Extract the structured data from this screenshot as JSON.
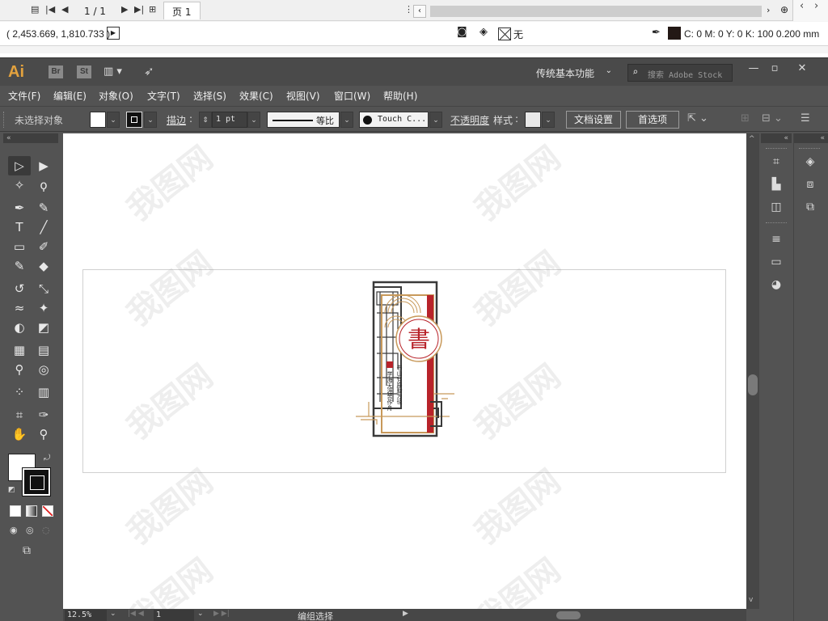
{
  "viewer": {
    "page_indicator": "1 / 1",
    "page_tab": "页 1",
    "coords": "( 2,453.669, 1,810.733 )",
    "stroke_none_label": "无",
    "color_readout": "C: 0 M: 0 Y: 0 K: 100  0.200 mm",
    "color_swatch": "#231815"
  },
  "app": {
    "logo": "Ai",
    "bridge": "Br",
    "stock": "St",
    "workspace": "传统基本功能",
    "search_placeholder": "搜索 Adobe Stock"
  },
  "menu": {
    "items": [
      "文件(F)",
      "编辑(E)",
      "对象(O)",
      "文字(T)",
      "选择(S)",
      "效果(C)",
      "视图(V)",
      "窗口(W)",
      "帮助(H)"
    ]
  },
  "control": {
    "selection": "未选择对象",
    "stroke_label": "描边",
    "stroke_weight": "1 pt",
    "profile": "等比",
    "brush": "Touch C...",
    "opacity_label": "不透明度",
    "style_label": "样式",
    "doc_setup": "文档设置",
    "preferences": "首选项"
  },
  "status": {
    "zoom": "12.5%",
    "artboard": "1",
    "tool_status": "编组选择"
  },
  "artwork": {
    "title_char": "書",
    "line1": "书山有路勤为径",
    "line2": "学海无涯苦作舟",
    "colors": {
      "red": "#b8232a",
      "gold": "#c8995a",
      "dark": "#3a3a3a"
    }
  },
  "watermark": "我图网"
}
